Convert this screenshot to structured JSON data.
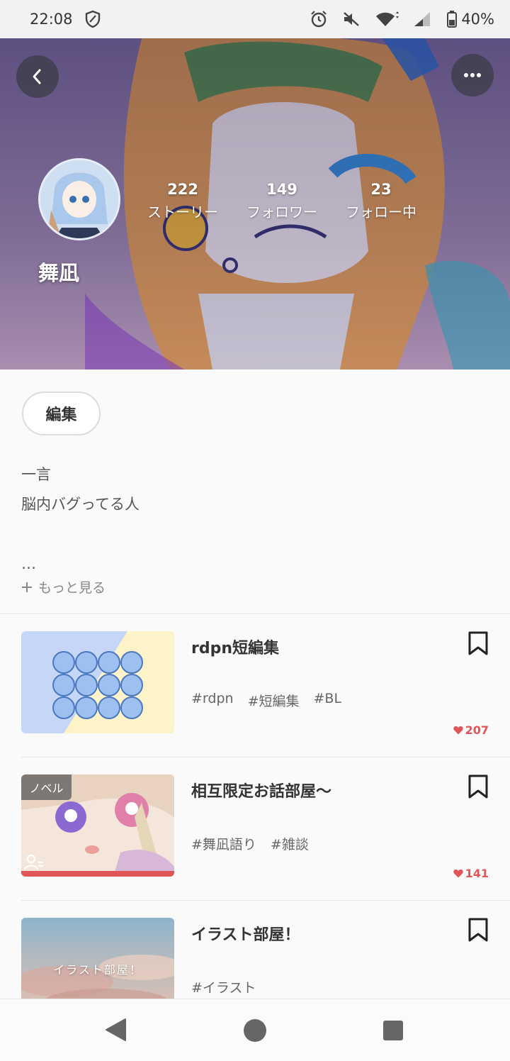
{
  "status_bar": {
    "time": "22:08",
    "battery": "40%"
  },
  "profile": {
    "name": "舞凪",
    "stats": [
      {
        "value": "222",
        "label": "ストーリー"
      },
      {
        "value": "149",
        "label": "フォロワー"
      },
      {
        "value": "23",
        "label": "フォロー中"
      }
    ],
    "edit_label": "編集",
    "bio_lines": [
      "一言",
      "脳内バグってる人"
    ],
    "bio_ellipsis": "…",
    "more_label": "もっと見る"
  },
  "stories": [
    {
      "title": "rdpn短編集",
      "tags": [
        "#rdpn",
        "#短編集",
        "#BL"
      ],
      "likes": "207"
    },
    {
      "title": "相互限定お話部屋〜",
      "tags": [
        "#舞凪語り",
        "#雑談"
      ],
      "likes": "141",
      "badge": "ノベル"
    },
    {
      "title": "イラスト部屋！",
      "tags": [
        "#イラスト"
      ],
      "thumb_text": "イラスト部屋！"
    }
  ],
  "colors": {
    "accent": "#e05555",
    "heart": "#e05555"
  },
  "icons": {
    "back": "chevron-left-icon",
    "more": "more-horizontal-icon",
    "bookmark": "bookmark-icon",
    "heart": "heart-icon",
    "plus": "plus-icon"
  }
}
